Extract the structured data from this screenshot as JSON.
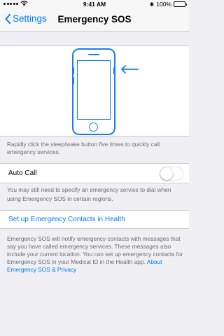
{
  "status_bar": {
    "time": "9:41 AM",
    "battery_percent": "100%",
    "bluetooth_glyph": "✱"
  },
  "navbar": {
    "back_label": "Settings",
    "title": "Emergency SOS"
  },
  "hero": {
    "icon": "iphone-sleep-wake-button-illustration"
  },
  "hero_caption": "Rapidly click the sleep/wake button five times to quickly call emergency services.",
  "auto_call": {
    "label": "Auto Call",
    "enabled": false,
    "caption": "You may still need to specify an emergency service to dial when using Emergency SOS in certain regions."
  },
  "setup_contacts": {
    "label": "Set up Emergency Contacts in Health"
  },
  "info": {
    "text": "Emergency SOS will notify emergency contacts with messages that say you have called emergency services. These messages also include your current location. You can set up emergency contacts for Emergency SOS in your Medical ID in the Health app.",
    "link": "About Emergency SOS & Privacy"
  },
  "colors": {
    "accent": "#007aff",
    "illustration": "#1a7cf5",
    "background": "#efeff4"
  }
}
